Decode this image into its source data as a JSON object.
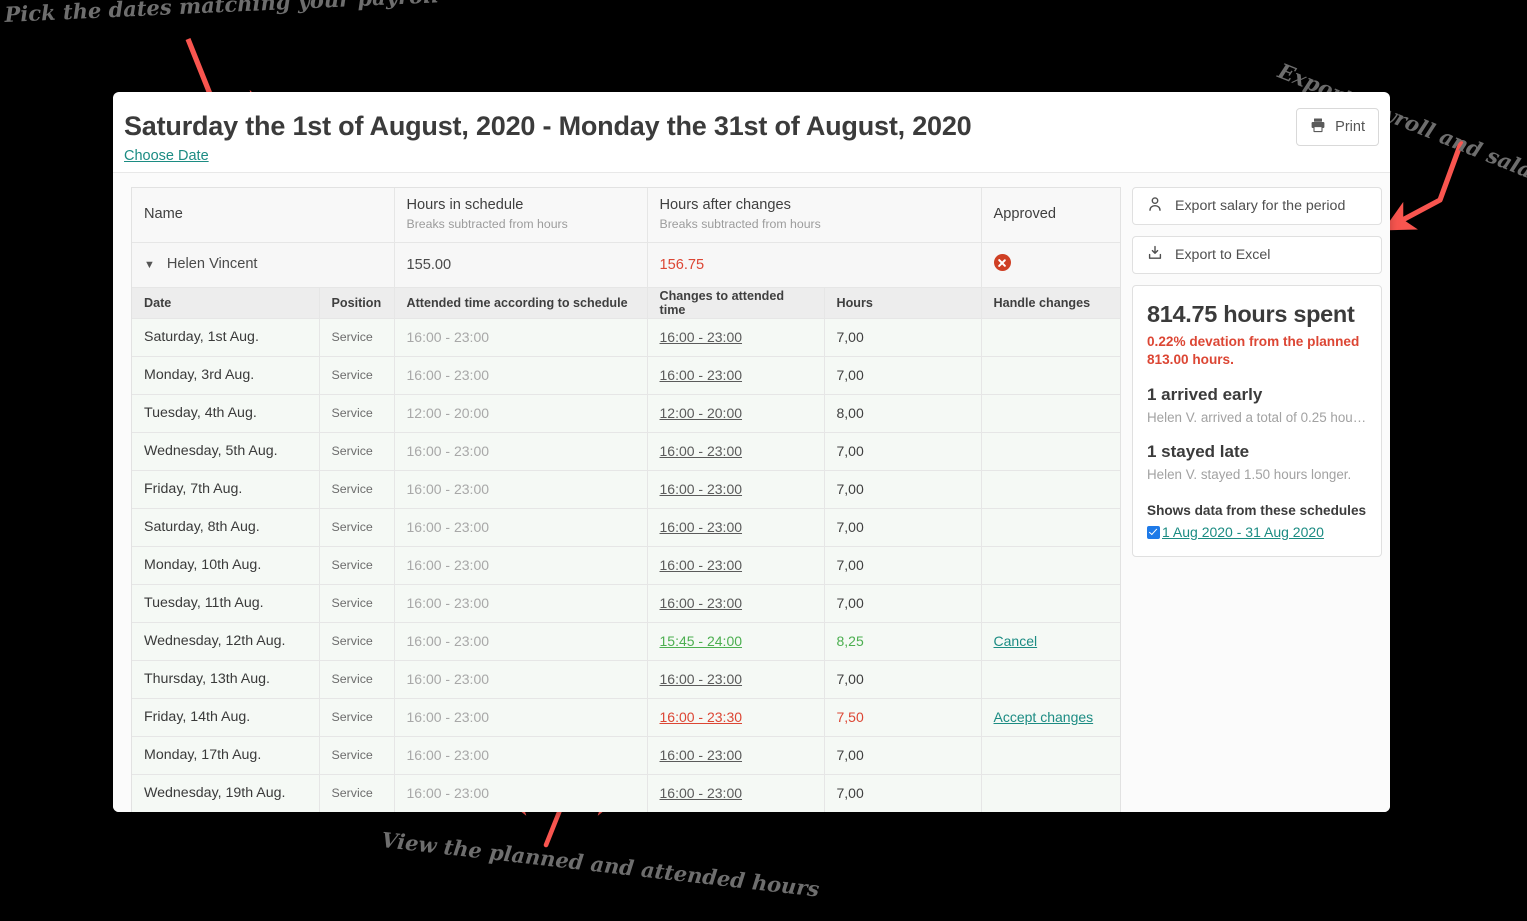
{
  "header": {
    "title": "Saturday the 1st of August, 2020 - Monday the 31st of August, 2020",
    "choose_date_label": "Choose Date",
    "print_label": "Print",
    "print_icon": "printer-icon"
  },
  "table": {
    "main_headers": [
      {
        "title": "Name",
        "sub": ""
      },
      {
        "title": "Hours in schedule",
        "sub": "Breaks subtracted from hours"
      },
      {
        "title": "Hours after changes",
        "sub": "Breaks subtracted from hours"
      },
      {
        "title": "Approved",
        "sub": ""
      }
    ],
    "employee": {
      "caret": "▼",
      "name": "Helen Vincent",
      "hours_in_schedule": "155.00",
      "hours_after_changes": "156.75",
      "approved_icon": "error-circle-icon"
    },
    "sub_headers": [
      "Date",
      "Position",
      "Attended time according to schedule",
      "Changes to attended time",
      "Hours",
      "Handle changes"
    ],
    "rows": [
      {
        "date": "Saturday, 1st Aug.",
        "position": "Service",
        "scheduled": "16:00 - 23:00",
        "changed": "16:00 - 23:00",
        "hours": "7,00",
        "handle": "",
        "state": "normal"
      },
      {
        "date": "Monday, 3rd Aug.",
        "position": "Service",
        "scheduled": "16:00 - 23:00",
        "changed": "16:00 - 23:00",
        "hours": "7,00",
        "handle": "",
        "state": "normal"
      },
      {
        "date": "Tuesday, 4th Aug.",
        "position": "Service",
        "scheduled": "12:00 - 20:00",
        "changed": "12:00 - 20:00",
        "hours": "8,00",
        "handle": "",
        "state": "normal"
      },
      {
        "date": "Wednesday, 5th Aug.",
        "position": "Service",
        "scheduled": "16:00 - 23:00",
        "changed": "16:00 - 23:00",
        "hours": "7,00",
        "handle": "",
        "state": "normal"
      },
      {
        "date": "Friday, 7th Aug.",
        "position": "Service",
        "scheduled": "16:00 - 23:00",
        "changed": "16:00 - 23:00",
        "hours": "7,00",
        "handle": "",
        "state": "normal"
      },
      {
        "date": "Saturday, 8th Aug.",
        "position": "Service",
        "scheduled": "16:00 - 23:00",
        "changed": "16:00 - 23:00",
        "hours": "7,00",
        "handle": "",
        "state": "normal"
      },
      {
        "date": "Monday, 10th Aug.",
        "position": "Service",
        "scheduled": "16:00 - 23:00",
        "changed": "16:00 - 23:00",
        "hours": "7,00",
        "handle": "",
        "state": "normal"
      },
      {
        "date": "Tuesday, 11th Aug.",
        "position": "Service",
        "scheduled": "16:00 - 23:00",
        "changed": "16:00 - 23:00",
        "hours": "7,00",
        "handle": "",
        "state": "normal"
      },
      {
        "date": "Wednesday, 12th Aug.",
        "position": "Service",
        "scheduled": "16:00 - 23:00",
        "changed": "15:45 - 24:00",
        "hours": "8,25",
        "handle": "Cancel",
        "state": "green"
      },
      {
        "date": "Thursday, 13th Aug.",
        "position": "Service",
        "scheduled": "16:00 - 23:00",
        "changed": "16:00 - 23:00",
        "hours": "7,00",
        "handle": "",
        "state": "normal"
      },
      {
        "date": "Friday, 14th Aug.",
        "position": "Service",
        "scheduled": "16:00 - 23:00",
        "changed": "16:00 - 23:30",
        "hours": "7,50",
        "handle": "Accept changes",
        "state": "red"
      },
      {
        "date": "Monday, 17th Aug.",
        "position": "Service",
        "scheduled": "16:00 - 23:00",
        "changed": "16:00 - 23:00",
        "hours": "7,00",
        "handle": "",
        "state": "normal"
      },
      {
        "date": "Wednesday, 19th Aug.",
        "position": "Service",
        "scheduled": "16:00 - 23:00",
        "changed": "16:00 - 23:00",
        "hours": "7,00",
        "handle": "",
        "state": "normal"
      }
    ]
  },
  "sidebar": {
    "export_salary_label": "Export salary for the period",
    "export_salary_icon": "person-icon",
    "export_excel_label": "Export to Excel",
    "export_excel_icon": "download-tray-icon",
    "summary": {
      "hours_spent": "814.75 hours spent",
      "deviation": "0.22% devation from the planned 813.00 hours.",
      "early_title": "1 arrived early",
      "early_desc": "Helen V. arrived a total of 0.25 hour…",
      "late_title": "1 stayed late",
      "late_desc": "Helen V. stayed 1.50 hours longer.",
      "schedules_title": "Shows data from these schedules",
      "schedule_item": "1 Aug 2020 - 31 Aug 2020"
    }
  },
  "annotations": {
    "dates": "Pick the dates matching your payroll",
    "export": "Export payroll and salary",
    "hours": "View the planned and attended hours"
  },
  "colors": {
    "accent_teal": "#1c8c83",
    "danger_red": "#dc4634",
    "success_green": "#4caf50",
    "checkbox_blue": "#1e7ae8",
    "annotation_arrow": "#f9554f"
  }
}
